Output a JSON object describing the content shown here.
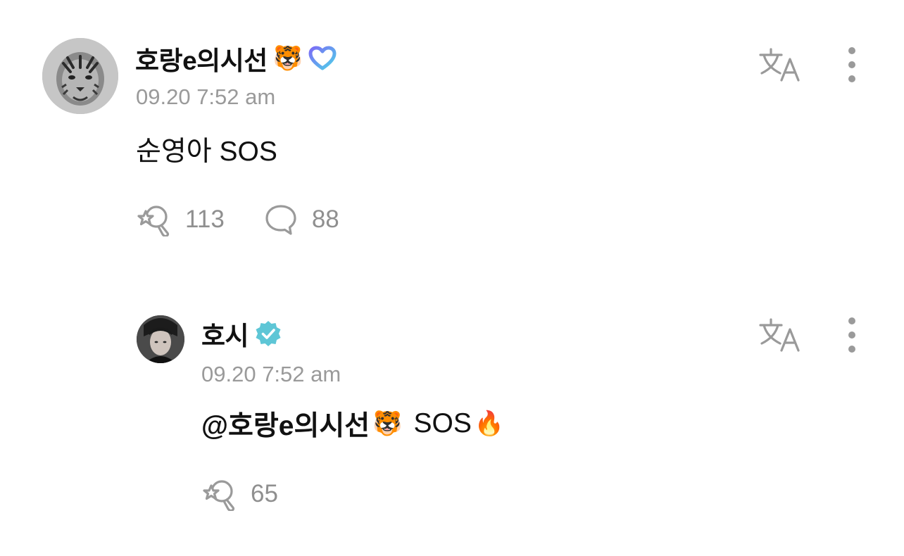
{
  "comments": [
    {
      "author": "호랑e의시선",
      "author_emoji": "🐯",
      "badge": "membership-heart-icon",
      "avatar": "tiger-avatar",
      "timestamp": "09.20 7:52 am",
      "text": "순영아 SOS",
      "likes": "113",
      "replies": "88"
    },
    {
      "author": "호시",
      "badge": "verified-badge-icon",
      "avatar": "artist-avatar",
      "timestamp": "09.20 7:52 am",
      "mention": "@호랑e의시선",
      "mention_emoji": "🐯",
      "text": "SOS",
      "trailing_emoji": "🔥",
      "likes": "65"
    }
  ],
  "colors": {
    "verified_badge": "#5ec6d6",
    "membership_heart_start": "#7b6cf6",
    "membership_heart_end": "#4fd1e8",
    "meta_gray": "#9a9a9a"
  }
}
